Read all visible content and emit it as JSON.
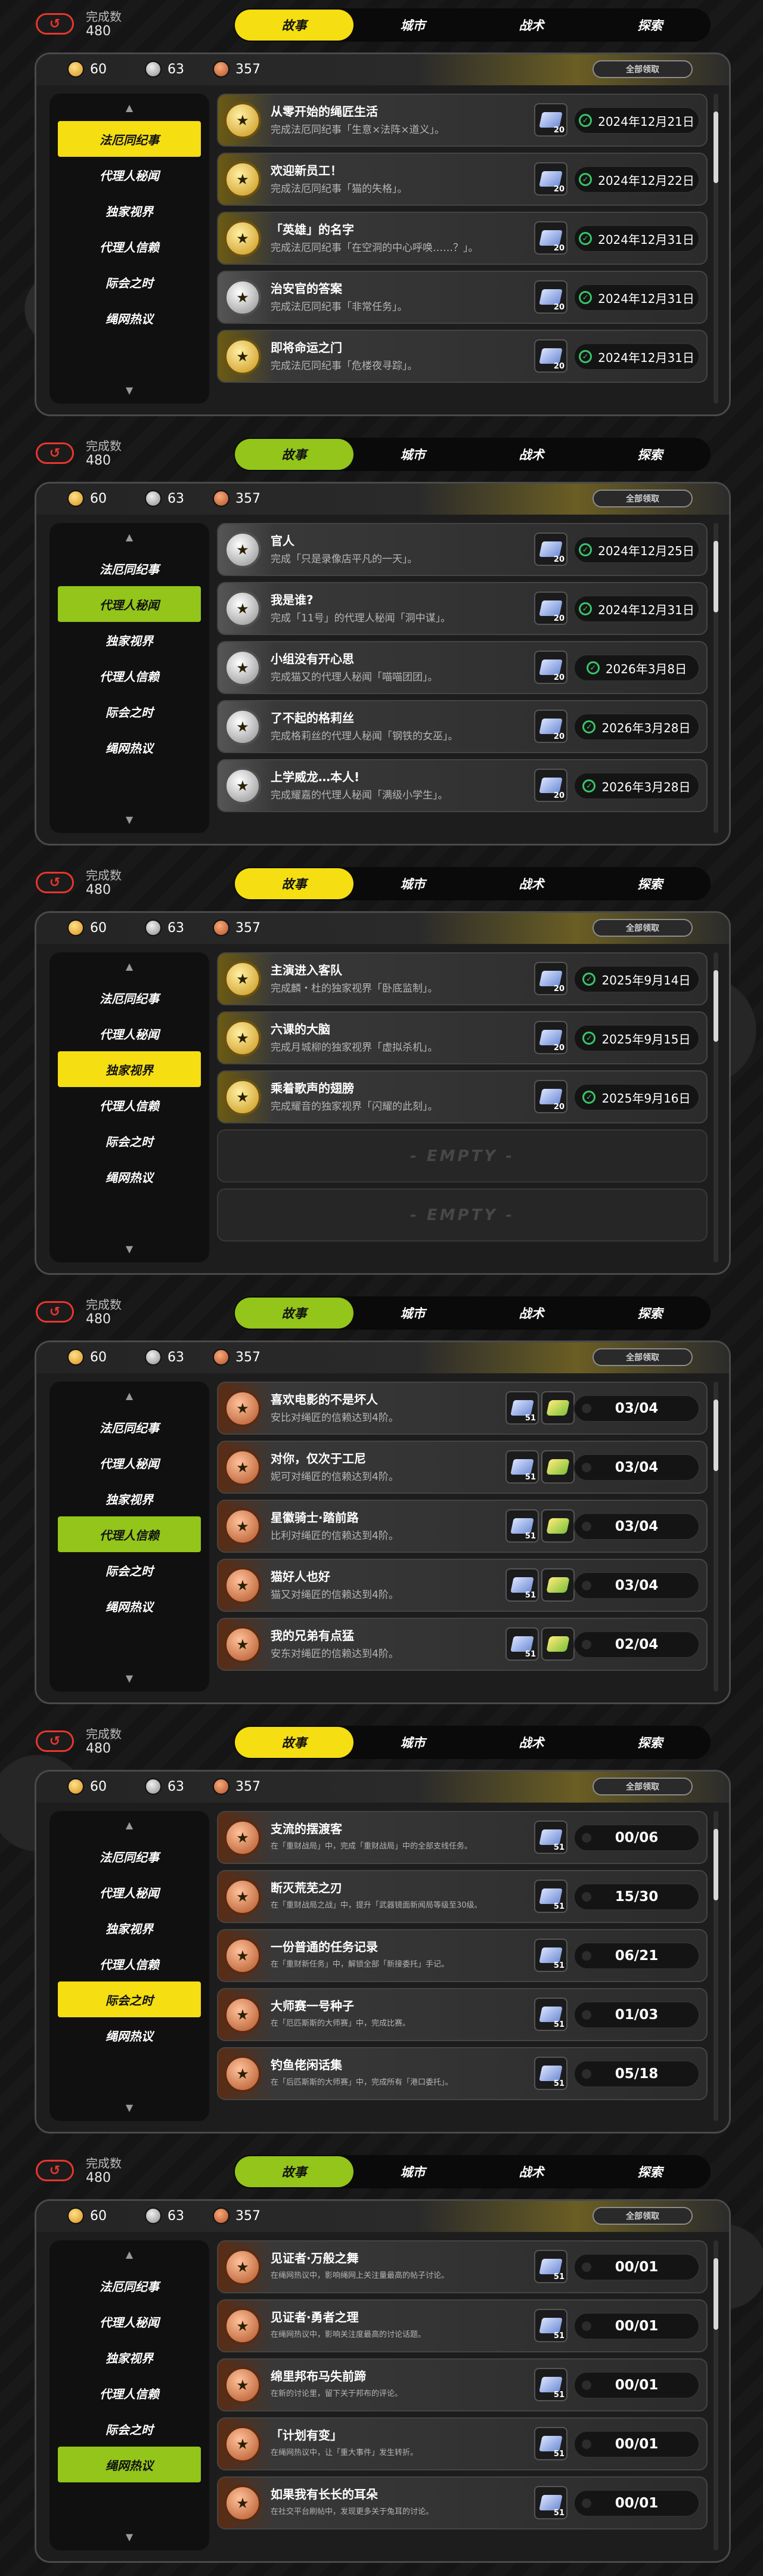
{
  "header": {
    "progress_label": "完成数",
    "progress_value": "480",
    "tabs": [
      "故事",
      "城市",
      "战术",
      "探索"
    ]
  },
  "resources": {
    "gold": "60",
    "silver": "63",
    "copper": "357"
  },
  "claim_all": "全部领取",
  "empty_label": "- EMPTY -",
  "categories": [
    "法厄同纪事",
    "代理人秘闻",
    "独家视界",
    "代理人信赖",
    "际会之时",
    "绳网热议"
  ],
  "colors": {
    "yellow": "#f5de12",
    "green": "#93c51a",
    "check": "#39c46a"
  },
  "sections": [
    {
      "tab_theme": "yellow",
      "selected": 0,
      "rows": [
        {
          "medal": "gold",
          "title": "从零开始的绳匠生活",
          "desc": "完成法厄同纪事「生意×法阵×道义」。",
          "reward": "20",
          "status": "2024年12月21日"
        },
        {
          "medal": "gold",
          "title": "欢迎新员工！",
          "desc": "完成法厄同纪事「猫的失格」。",
          "reward": "20",
          "status": "2024年12月22日"
        },
        {
          "medal": "gold",
          "title": "「英雄」的名字",
          "desc": "完成法厄同纪事「在空洞的中心呼唤……？」。",
          "reward": "20",
          "status": "2024年12月31日"
        },
        {
          "medal": "silver",
          "title": "治安官的答案",
          "desc": "完成法厄同纪事「非常任务」。",
          "reward": "20",
          "status": "2024年12月31日"
        },
        {
          "medal": "gold",
          "title": "即将命运之门",
          "desc": "完成法厄同纪事「危楼夜寻踪」。",
          "reward": "20",
          "status": "2024年12月31日"
        }
      ]
    },
    {
      "tab_theme": "green",
      "selected": 1,
      "rows": [
        {
          "medal": "silver",
          "title": "官人",
          "desc": "完成「只是录像店平凡的一天」。",
          "reward": "20",
          "status": "2024年12月25日"
        },
        {
          "medal": "silver",
          "title": "我是谁?",
          "desc": "完成「11号」的代理人秘闻「洞中谋」。",
          "reward": "20",
          "status": "2024年12月31日"
        },
        {
          "medal": "silver",
          "title": "小组没有开心思",
          "desc": "完成猫又的代理人秘闻「喵喵团团」。",
          "reward": "20",
          "status": "2026年3月8日"
        },
        {
          "medal": "silver",
          "title": "了不起的格莉丝",
          "desc": "完成格莉丝的代理人秘闻「钢铁的女巫」。",
          "reward": "20",
          "status": "2026年3月28日"
        },
        {
          "medal": "silver",
          "title": "上学威龙…本人!",
          "desc": "完成耀嘉的代理人秘闻「满级小学生」。",
          "reward": "20",
          "status": "2026年3月28日"
        }
      ]
    },
    {
      "tab_theme": "yellow",
      "selected": 2,
      "rows": [
        {
          "medal": "gold",
          "title": "主演进入客队",
          "desc": "完成麟・杜的独家视界「卧底监制」。",
          "reward": "20",
          "status": "2025年9月14日"
        },
        {
          "medal": "gold",
          "title": "六课的大脑",
          "desc": "完成月城柳的独家视界「虚拟杀机」。",
          "reward": "20",
          "status": "2025年9月15日"
        },
        {
          "medal": "gold",
          "title": "乘着歌声的翅膀",
          "desc": "完成耀音的独家视界「闪耀的此刻」。",
          "reward": "20",
          "status": "2025年9月16日"
        },
        {
          "empty": true
        },
        {
          "empty": true
        }
      ]
    },
    {
      "tab_theme": "green",
      "selected": 3,
      "rows": [
        {
          "medal": "copper",
          "title": "喜欢电影的不是坏人",
          "desc": "安比对绳匠的信赖达到4阶。",
          "reward": "51",
          "chip": true,
          "status": "03/04"
        },
        {
          "medal": "copper",
          "title": "对你，仅次于工尼",
          "desc": "妮可对绳匠的信赖达到4阶。",
          "reward": "51",
          "chip": true,
          "status": "03/04"
        },
        {
          "medal": "copper",
          "title": "星徽骑士·踏前路",
          "desc": "比利对绳匠的信赖达到4阶。",
          "reward": "51",
          "chip": true,
          "status": "03/04"
        },
        {
          "medal": "copper",
          "title": "猫好人也好",
          "desc": "猫又对绳匠的信赖达到4阶。",
          "reward": "51",
          "chip": true,
          "status": "03/04"
        },
        {
          "medal": "copper",
          "title": "我的兄弟有点猛",
          "desc": "安东对绳匠的信赖达到4阶。",
          "reward": "51",
          "chip": true,
          "status": "02/04"
        }
      ]
    },
    {
      "tab_theme": "yellow",
      "selected": 4,
      "rows": [
        {
          "medal": "copper",
          "title": "支流的摆渡客",
          "desc": "在「重财战局」中，完成「重财战局」中的全部支线任务。",
          "small": true,
          "reward": "51",
          "status": "00/06"
        },
        {
          "medal": "copper",
          "title": "断灭荒芜之刃",
          "desc": "在「重财战局之战」中，提升「武器镜面新闻局等级至30级。",
          "small": true,
          "reward": "51",
          "status": "15/30"
        },
        {
          "medal": "copper",
          "title": "一份普通的任务记录",
          "desc": "在「重财新任务」中，解锁全部「新接委托」手记。",
          "small": true,
          "reward": "51",
          "status": "06/21"
        },
        {
          "medal": "copper",
          "title": "大师赛一号种子",
          "desc": "在「厄匹斯斯的大师赛」中，完成比赛。",
          "small": true,
          "reward": "51",
          "status": "01/03"
        },
        {
          "medal": "copper",
          "title": "钓鱼佬闲话集",
          "desc": "在「后匹斯斯的大师赛」中，完成所有「港口委托」。",
          "small": true,
          "reward": "51",
          "status": "05/18"
        }
      ]
    },
    {
      "tab_theme": "green",
      "selected": 5,
      "rows": [
        {
          "medal": "copper",
          "title": "见证者·万般之舞",
          "desc": "在绳网热议中，影响绳网上关注量最高的帖子讨论。",
          "small": true,
          "reward": "51",
          "status": "00/01"
        },
        {
          "medal": "copper",
          "title": "见证者·勇者之理",
          "desc": "在绳网热议中，影响关注度最高的讨论话题。",
          "small": true,
          "reward": "51",
          "status": "00/01"
        },
        {
          "medal": "copper",
          "title": "绵里邦布马失前蹄",
          "desc": "在新的讨论里，留下关于邦布的评论。",
          "small": true,
          "reward": "51",
          "status": "00/01"
        },
        {
          "medal": "copper",
          "title": "「计划有变」",
          "desc": "在绳网热议中，让「重大事件」发生转折。",
          "small": true,
          "reward": "51",
          "status": "00/01"
        },
        {
          "medal": "copper",
          "title": "如果我有长长的耳朵",
          "desc": "在社交平台刷帖中，发现更多关于兔耳的讨论。",
          "small": true,
          "reward": "51",
          "status": "00/01"
        }
      ]
    }
  ]
}
